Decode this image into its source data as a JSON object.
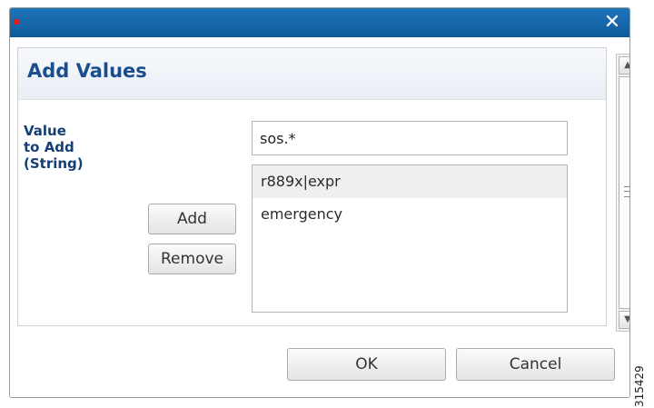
{
  "dialog": {
    "close_symbol": "✕",
    "panel_title": "Add Values",
    "field_label": "Value to Add (String)",
    "input_value": "sos.*",
    "list_items": [
      "r889x|expr",
      "emergency"
    ],
    "add_label": "Add",
    "remove_label": "Remove",
    "ok_label": "OK",
    "cancel_label": "Cancel"
  },
  "figure_id": "315429",
  "colors": {
    "titlebar": "#1467a9",
    "title_text": "#1a4d8c",
    "label_text": "#153e75",
    "marker": "#d61f1f"
  },
  "icons": {
    "close": "close-icon",
    "scroll_up": "scroll-up-icon",
    "scroll_down": "scroll-down-icon",
    "grip": "grip-icon"
  }
}
